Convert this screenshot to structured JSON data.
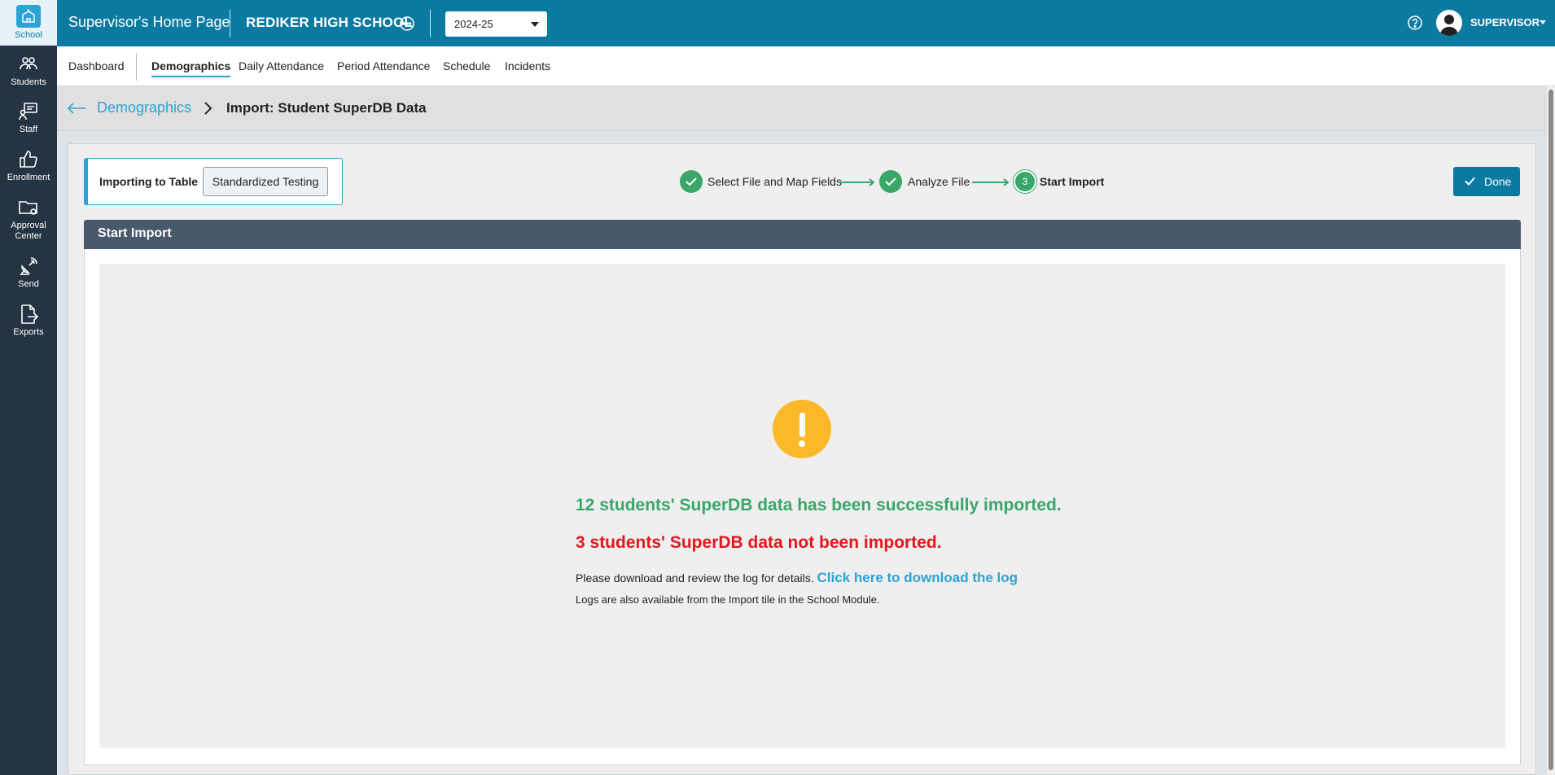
{
  "rail": {
    "items": [
      {
        "label": "School",
        "icon": "school-icon"
      },
      {
        "label": "Students",
        "icon": "students-icon"
      },
      {
        "label": "Staff",
        "icon": "staff-icon"
      },
      {
        "label": "Enrollment",
        "icon": "thumbs-up-icon"
      },
      {
        "label": "Approval Center",
        "icon": "folder-gear-icon"
      },
      {
        "label": "Send",
        "icon": "satellite-icon"
      },
      {
        "label": "Exports",
        "icon": "export-file-icon"
      }
    ]
  },
  "header": {
    "home_title": "Supervisor's Home Page",
    "school_name": "REDIKER HIGH SCHOOL",
    "year": "2024-25",
    "user": "SUPERVISOR"
  },
  "tabs": [
    "Dashboard",
    "Demographics",
    "Daily Attendance",
    "Period Attendance",
    "Schedule",
    "Incidents"
  ],
  "active_tab": "Demographics",
  "breadcrumb": {
    "parent": "Demographics",
    "current": "Import: Student SuperDB Data"
  },
  "import": {
    "label": "Importing to Table",
    "table": "Standardized Testing"
  },
  "steps": [
    {
      "label": "Select File and Map Fields",
      "state": "complete"
    },
    {
      "label": "Analyze File",
      "state": "complete"
    },
    {
      "label": "Start Import",
      "state": "current",
      "number": "3"
    }
  ],
  "done_label": "Done",
  "panel": {
    "title": "Start Import",
    "success_message": "12 students' SuperDB data has been successfully imported.",
    "fail_message": "3 students' SuperDB data not been imported.",
    "detail_text": "Please download and review the log for details.",
    "download_link": "Click here to download the log",
    "note": "Logs are also available from the Import tile in the School Module."
  },
  "colors": {
    "brand": "#0b7aa1",
    "accent": "#2ba3d4",
    "success": "#3aa66a",
    "error": "#e5161c",
    "warning": "#fbb827",
    "rail": "#253443"
  }
}
